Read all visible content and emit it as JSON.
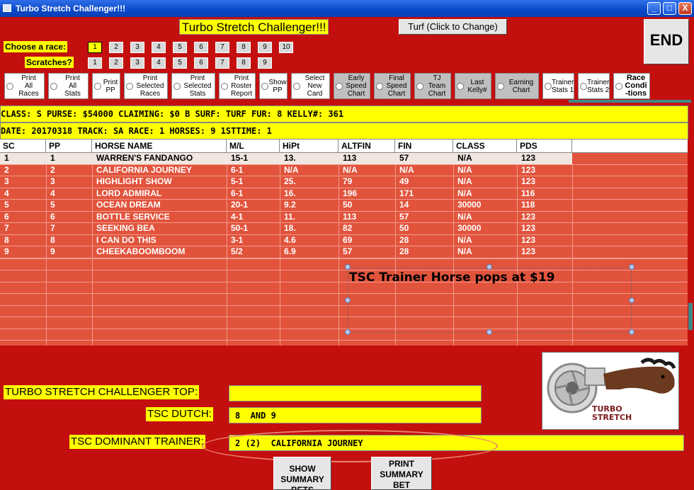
{
  "window": {
    "title": "Turbo Stretch Challenger!!!",
    "minimize": "_",
    "maximize": "□",
    "close": "X"
  },
  "header": {
    "app_title": "Turbo Stretch Challenger!!!",
    "turf_button": "Turf (Click to Change)",
    "end_button": "END"
  },
  "races": {
    "label": "Choose  a race:",
    "items": [
      "1",
      "2",
      "3",
      "4",
      "5",
      "6",
      "7",
      "8",
      "9",
      "10"
    ],
    "selected": "1"
  },
  "scratches": {
    "label": "Scratches?",
    "items": [
      "1",
      "2",
      "3",
      "4",
      "5",
      "6",
      "7",
      "8",
      "9"
    ]
  },
  "options": [
    {
      "label": "Print\nAll\nRaces",
      "style": "white"
    },
    {
      "label": "Print\nAll\nStats",
      "style": "white"
    },
    {
      "label": "Print\nPP",
      "style": "white"
    },
    {
      "label": "Print\nSelected\nRaces",
      "style": "white"
    },
    {
      "label": "Print\nSelected\nStats",
      "style": "white"
    },
    {
      "label": "Print\nRoster\nReport",
      "style": "white"
    },
    {
      "label": "Show\nPP",
      "style": "white"
    },
    {
      "label": "Select\nNew\nCard",
      "style": "white"
    },
    {
      "label": "Early\nSpeed\nChart",
      "style": "gray"
    },
    {
      "label": "Final\nSpeed\nChart",
      "style": "gray"
    },
    {
      "label": "TJ\nTeam\nChart",
      "style": "gray"
    },
    {
      "label": "Last\nKelly#",
      "style": "gray"
    },
    {
      "label": "Earning\nChart",
      "style": "gray"
    },
    {
      "label": "Trainer\nStats 1",
      "style": "white"
    },
    {
      "label": "Trainer\nStats 2",
      "style": "white"
    },
    {
      "label": "Race\nCondi\n-tions",
      "style": "bold"
    }
  ],
  "info1": "  CLASS: S    PURSE: $54000  CLAIMING: $0 B  SURF: TURF    FUR: 8  KELLY#: 361",
  "info2": "       DATE: 20170318       TRACK: SA          RACE: 1        HORSES: 9       1STTIME:  1",
  "table": {
    "headers": [
      "SC",
      "PP",
      "HORSE NAME",
      "M/L",
      "HiPt",
      "ALTFIN",
      "FIN",
      "CLASS",
      "PDS"
    ],
    "rows": [
      [
        "1",
        "1",
        "WARREN'S FANDANGO",
        "15-1",
        "13.",
        "113",
        "57",
        "N/A",
        "123"
      ],
      [
        "2",
        "2",
        "CALIFORNIA JOURNEY",
        "6-1",
        "N/A",
        "N/A",
        "N/A",
        "N/A",
        "123"
      ],
      [
        "3",
        "3",
        "HIGHLIGHT SHOW",
        "5-1",
        "25.",
        "79",
        "49",
        "N/A",
        "123"
      ],
      [
        "4",
        "4",
        "LORD ADMIRAL",
        "6-1",
        "16.",
        "196",
        "171",
        "N/A",
        "116"
      ],
      [
        "5",
        "5",
        "OCEAN DREAM",
        "20-1",
        "9.2",
        "50",
        "14",
        "30000",
        "118"
      ],
      [
        "6",
        "6",
        "BOTTLE SERVICE",
        "4-1",
        "11.",
        "113",
        "57",
        "N/A",
        "123"
      ],
      [
        "7",
        "7",
        "SEEKING BEA",
        "50-1",
        "18.",
        "82",
        "50",
        "30000",
        "123"
      ],
      [
        "8",
        "8",
        "I CAN DO THIS",
        "3-1",
        "4.6",
        "69",
        "28",
        "N/A",
        "123"
      ],
      [
        "9",
        "9",
        "CHEEKABOOMBOOM",
        "5/2",
        "6.9",
        "57",
        "28",
        "N/A",
        "123"
      ]
    ]
  },
  "annotation": "TSC Trainer Horse pops at $19",
  "bottom": {
    "top_label": "TURBO STRETCH CHALLENGER TOP:",
    "top_value": "",
    "dutch_label": "TSC DUTCH:",
    "dutch_value": "8  AND 9",
    "dominant_label": "TSC DOMINANT TRAINER:",
    "dominant_value": "2 (2)  CALIFORNIA JOURNEY",
    "show_summary": "SHOW SUMMARY BETS",
    "print_summary": "PRINT SUMMARY BET"
  },
  "logo_text": "TURBO STRETCH",
  "colors": {
    "background": "#c40f0f",
    "grid": "#e2533c",
    "highlight": "#ffff00"
  }
}
